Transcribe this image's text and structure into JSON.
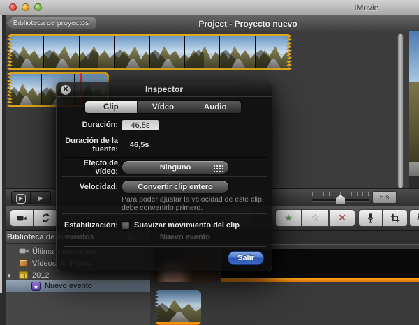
{
  "window": {
    "title": "iMovie"
  },
  "project_header": {
    "back_button": "Biblioteca de proyectos",
    "title": "Project - Proyecto nuevo"
  },
  "inspector": {
    "title": "Inspector",
    "tabs": [
      {
        "label": "Clip",
        "active": true
      },
      {
        "label": "Vídeo",
        "active": false
      },
      {
        "label": "Audio",
        "active": false
      }
    ],
    "duration_label": "Duración:",
    "duration_value": "46,5s",
    "source_duration_label": "Duración de la fuente:",
    "source_duration_value": "46,5s",
    "video_effect_label": "Efecto de vídeo:",
    "video_effect_button": "Ninguno",
    "speed_label": "Velocidad:",
    "speed_button": "Convertir clip entero",
    "speed_help_line1": "Para poder ajustar la velocidad de este clip,",
    "speed_help_line2": "debe convertirlo primero.",
    "stabilization_label": "Estabilización:",
    "stabilization_option": "Suavizar movimiento del clip",
    "stabilization_checked": false,
    "exit_button": "Salir"
  },
  "event_library": {
    "header": "Biblioteca de eventos",
    "items": [
      {
        "label": "Última importación",
        "icon": "camera-icon"
      },
      {
        "label": "Vídeos de iPhoto",
        "icon": "photo-icon"
      },
      {
        "label": "2012",
        "icon": "calendar-icon",
        "expanded": true
      },
      {
        "label": "Nuevo evento",
        "icon": "star-icon",
        "selected": true
      }
    ]
  },
  "event_browser": {
    "header": "Nuevo evento"
  },
  "transport": {
    "zoom_value": "5 s"
  },
  "icons": {
    "favorite_star": "★",
    "unrate_star": "☆",
    "reject_x": "✕",
    "play": "▶",
    "star_badge": "★",
    "close_x": "✕"
  },
  "colors": {
    "selection_yellow": "#dfa61c",
    "marked_orange": "#f08a05",
    "exit_button_blue": "#3d6ac4",
    "favorite_green": "#5d8f5d",
    "reject_red": "#a05a5a"
  }
}
